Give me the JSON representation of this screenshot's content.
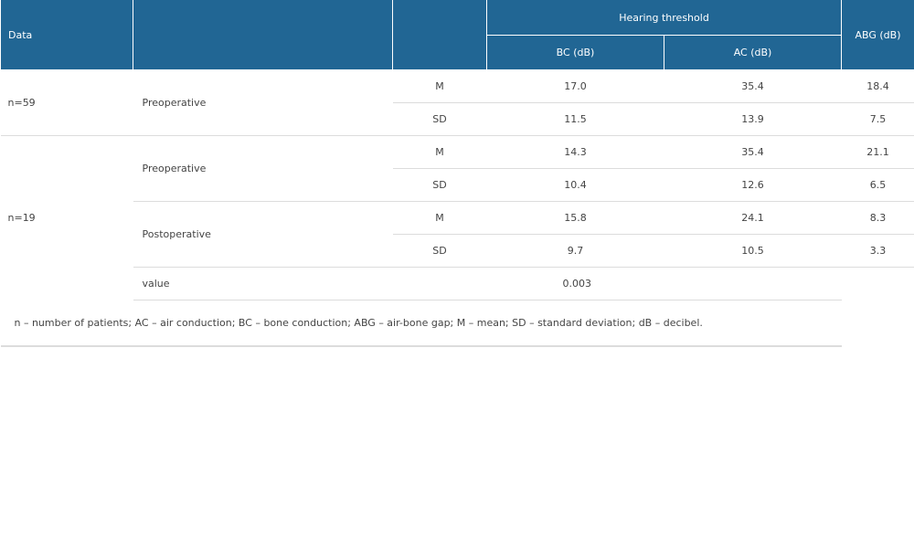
{
  "header": {
    "data_label": "Data",
    "group_label": "Hearing threshold",
    "bc_label": "BC (dB)",
    "ac_label": "AC (dB)",
    "abg_label": "ABG (dB)"
  },
  "group1": {
    "n": "n=59",
    "condition": "Preoperative",
    "m": {
      "stat": "M",
      "bc": "17.0",
      "ac": "35.4",
      "abg": "18.4"
    },
    "sd": {
      "stat": "SD",
      "bc": "11.5",
      "ac": "13.9",
      "abg": "7.5"
    }
  },
  "group2": {
    "n": "n=19",
    "pre": {
      "condition": "Preoperative",
      "m": {
        "stat": "M",
        "bc": "14.3",
        "ac": "35.4",
        "abg": "21.1"
      },
      "sd": {
        "stat": "SD",
        "bc": "10.4",
        "ac": "12.6",
        "abg": "6.5"
      }
    },
    "post": {
      "condition": "Postoperative",
      "m": {
        "stat": "M",
        "bc": "15.8",
        "ac": "24.1",
        "abg": "8.3"
      },
      "sd": {
        "stat": "SD",
        "bc": "9.7",
        "ac": "10.5",
        "abg": "3.3"
      }
    },
    "p_label": "value",
    "p_value": "0.003"
  },
  "footnote": "n – number of patients; AC – air conduction; BC – bone conduction; ABG – air-bone gap; M – mean; SD – standard deviation; dB – decibel."
}
